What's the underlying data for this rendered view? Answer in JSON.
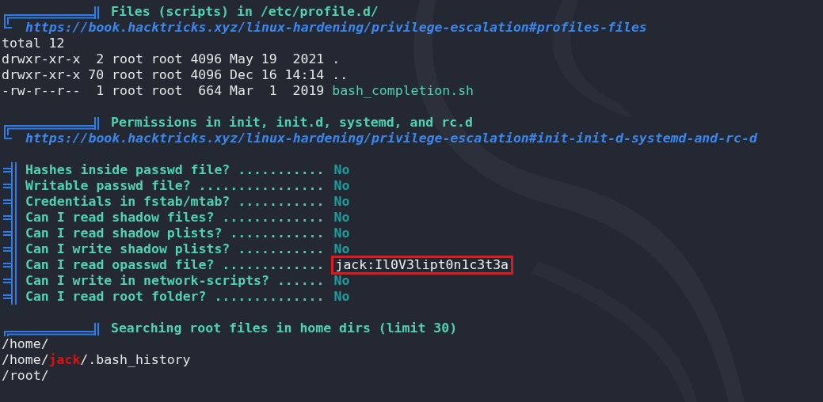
{
  "sections": [
    {
      "title": "Files (scripts) in /etc/profile.d/",
      "url": "https://book.hacktricks.xyz/linux-hardening/privilege-escalation#profiles-files",
      "lines": [
        [
          {
            "text": "total 12",
            "kind": "plain"
          }
        ],
        [
          {
            "text": "drwxr-xr-x  2 root root 4096 May 19  2021 .",
            "kind": "plain"
          }
        ],
        [
          {
            "text": "drwxr-xr-x 70 root root 4096 Dec 16 14:14 ..",
            "kind": "plain"
          }
        ],
        [
          {
            "text": "-rw-r--r--  1 root root  664 Mar  1  2019 ",
            "kind": "plain"
          },
          {
            "text": "bash_completion.sh",
            "kind": "file"
          }
        ]
      ]
    },
    {
      "title": "Permissions in init, init.d, systemd, and rc.d",
      "url": "https://book.hacktricks.xyz/linux-hardening/privilege-escalation#init-init-d-systemd-and-rc-d",
      "checks": [
        {
          "question": "Hashes inside passwd file? ...........",
          "answer": "No",
          "found": false
        },
        {
          "question": "Writable passwd file? ................",
          "answer": "No",
          "found": false
        },
        {
          "question": "Credentials in fstab/mtab? ...........",
          "answer": "No",
          "found": false
        },
        {
          "question": "Can I read shadow files? .............",
          "answer": "No",
          "found": false
        },
        {
          "question": "Can I read shadow plists? ............",
          "answer": "No",
          "found": false
        },
        {
          "question": "Can I write shadow plists? ...........",
          "answer": "No",
          "found": false
        },
        {
          "question": "Can I read opasswd file? .............",
          "answer": "jack:Il0V3lipt0n1c3t3a",
          "found": true
        },
        {
          "question": "Can I write in network-scripts? ......",
          "answer": "No",
          "found": false
        },
        {
          "question": "Can I read root folder? ..............",
          "answer": "No",
          "found": false
        }
      ]
    },
    {
      "title": "Searching root files in home dirs (limit 30)",
      "lines": [
        [
          {
            "text": "/home/",
            "kind": "plain"
          }
        ],
        [
          {
            "text": "/home/",
            "kind": "plain"
          },
          {
            "text": "jack",
            "kind": "user"
          },
          {
            "text": "/.bash_history",
            "kind": "plain"
          }
        ],
        [
          {
            "text": "/root/",
            "kind": "plain"
          }
        ]
      ]
    }
  ]
}
